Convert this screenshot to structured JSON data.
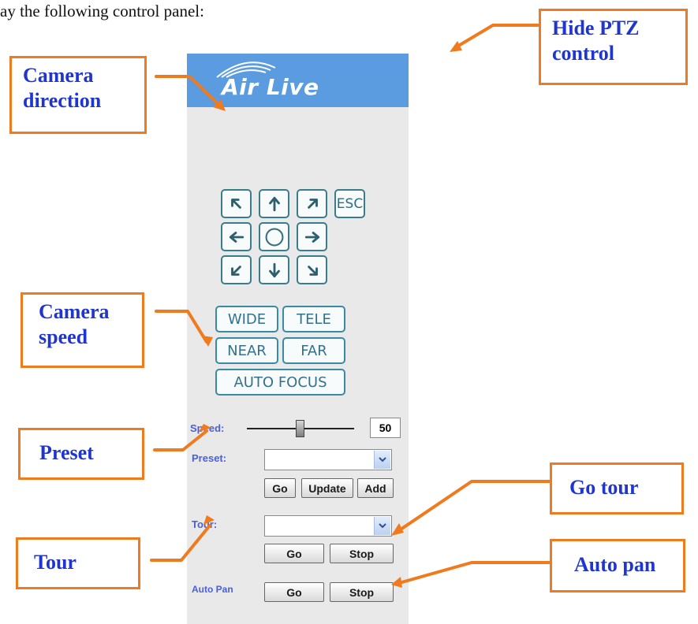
{
  "intro_text": "ay the following control panel:",
  "logo": {
    "text": "Air Live"
  },
  "direction": {
    "buttons": [
      {
        "name": "up-left-button",
        "icon": "arrow-up-left-icon"
      },
      {
        "name": "up-button",
        "icon": "arrow-up-icon"
      },
      {
        "name": "up-right-button",
        "icon": "arrow-up-right-icon"
      },
      {
        "name": "left-button",
        "icon": "arrow-left-icon"
      },
      {
        "name": "home-button",
        "icon": "circle-icon"
      },
      {
        "name": "right-button",
        "icon": "arrow-right-icon"
      },
      {
        "name": "down-left-button",
        "icon": "arrow-down-left-icon"
      },
      {
        "name": "down-button",
        "icon": "arrow-down-icon"
      },
      {
        "name": "down-right-button",
        "icon": "arrow-down-right-icon"
      }
    ],
    "esc_label": "ESC"
  },
  "lens": {
    "wide": "WIDE",
    "tele": "TELE",
    "near": "NEAR",
    "far": "FAR",
    "auto_focus": "AUTO FOCUS"
  },
  "speed": {
    "label": "Speed:",
    "value": "50",
    "fraction": 0.5
  },
  "preset": {
    "label": "Preset:",
    "selected": "",
    "go": "Go",
    "update": "Update",
    "add": "Add"
  },
  "tour": {
    "label": "Tour:",
    "selected": "",
    "go": "Go",
    "stop": "Stop"
  },
  "auto_pan": {
    "label": "Auto Pan",
    "go": "Go",
    "stop": "Stop"
  },
  "callouts": {
    "camera_direction": "Camera direction",
    "camera_speed": "Camera speed",
    "preset": "Preset",
    "tour": "Tour",
    "hide_ptz": "Hide PTZ control",
    "go_tour": "Go tour",
    "auto_pan": "Auto pan"
  },
  "colors": {
    "banner": "#5b9be0",
    "panel": "#e9e9e9",
    "callout_border": "#f07a1e",
    "callout_text": "#1f35d0"
  }
}
